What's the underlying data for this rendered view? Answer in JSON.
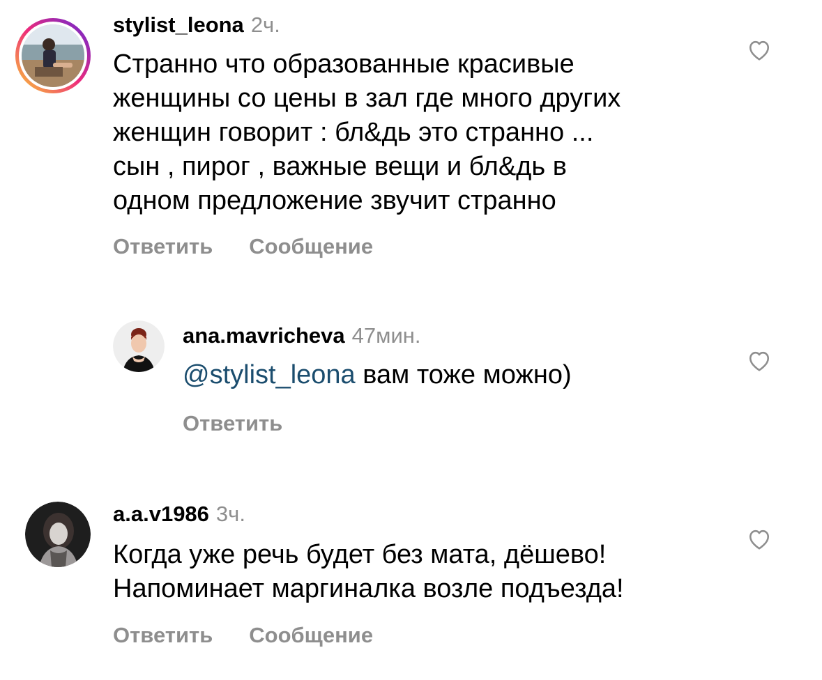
{
  "comments": [
    {
      "username": "stylist_leona",
      "time": "2ч.",
      "text": "Странно что образованные красивые\nженщины со цены в зал где много других\nженщин говорит : бл&дь это странно ...\nсын , пирог , важные вещи и бл&дь в\nодном предложение звучит странно",
      "reply_label": "Ответить",
      "message_label": "Сообщение",
      "like_icon": "heart-outline-icon",
      "story_ring_colors": [
        "#f9ce34",
        "#ee2a7b",
        "#6228d7"
      ]
    },
    {
      "username": "ana.mavricheva",
      "time": "47мин.",
      "mention": "@stylist_leona",
      "text": " вам тоже можно)",
      "reply_label": "Ответить",
      "like_icon": "heart-outline-icon"
    },
    {
      "username": "a.a.v1986",
      "time": "3ч.",
      "text": "Когда уже речь будет без мата, дёшево!\nНапоминает маргиналка возле подъезда!",
      "reply_label": "Ответить",
      "message_label": "Сообщение",
      "like_icon": "heart-outline-icon"
    }
  ],
  "colors": {
    "secondary_text": "#8e8e8e",
    "mention": "#1b4d6e"
  }
}
